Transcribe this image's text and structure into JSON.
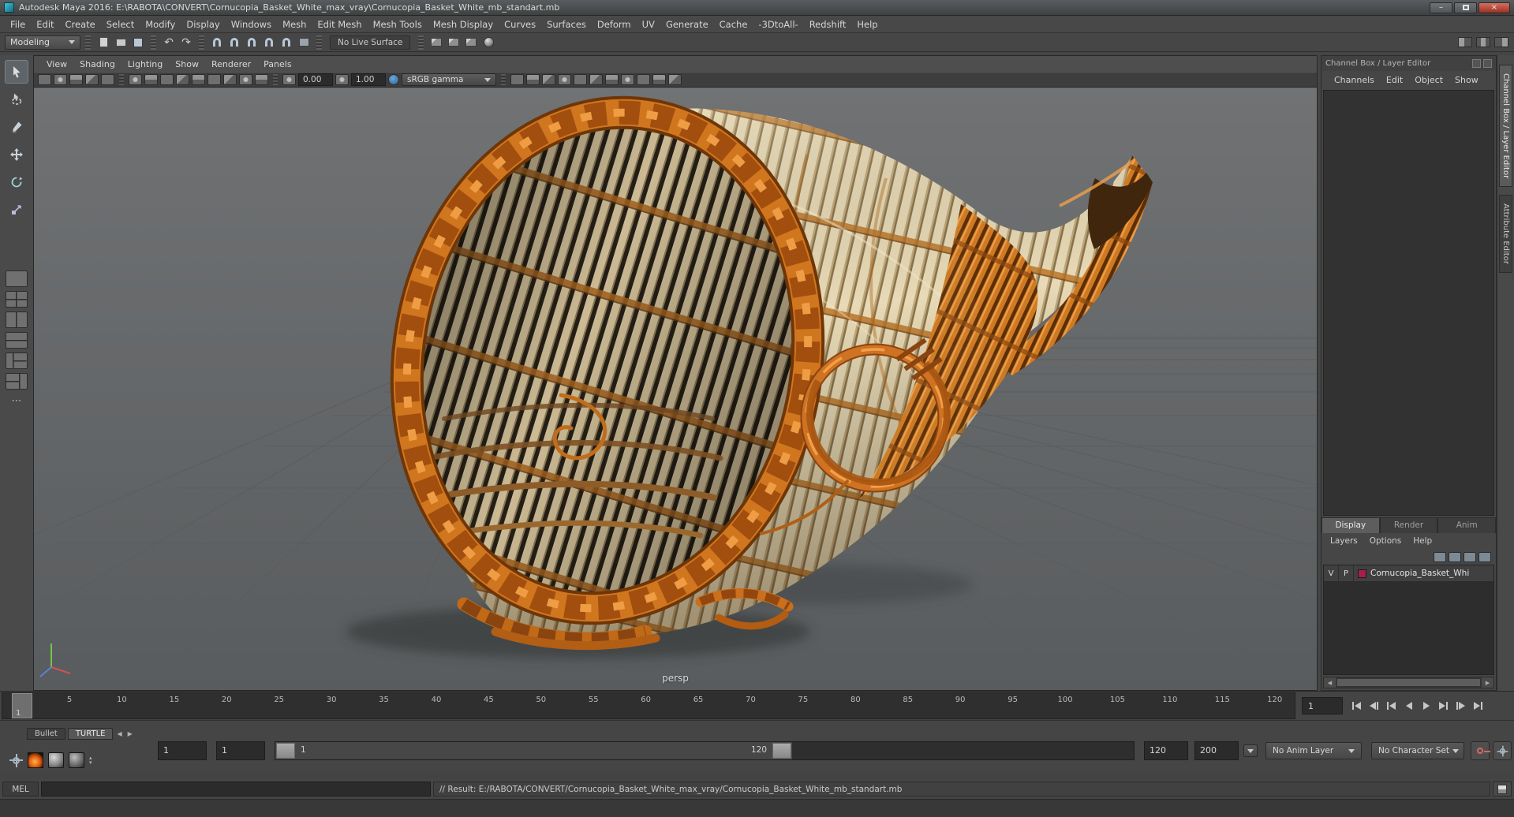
{
  "window": {
    "title": "Autodesk Maya 2016: E:\\RABOTA\\CONVERT\\Cornucopia_Basket_White_max_vray\\Cornucopia_Basket_White_mb_standart.mb"
  },
  "icons": {
    "minimize": "–",
    "close": "×",
    "undo": "↶",
    "redo": "↷",
    "more": "⋯",
    "arrow_left": "◀",
    "arrow_right": "▶",
    "spinner_up": "▴",
    "spinner_down": "▾"
  },
  "menu_bar": {
    "items": [
      "File",
      "Edit",
      "Create",
      "Select",
      "Modify",
      "Display",
      "Windows",
      "Mesh",
      "Edit Mesh",
      "Mesh Tools",
      "Mesh Display",
      "Curves",
      "Surfaces",
      "Deform",
      "UV",
      "Generate",
      "Cache",
      "-3DtoAll-",
      "Redshift",
      "Help"
    ]
  },
  "status_line": {
    "mode": "Modeling",
    "live_surface": "No Live Surface"
  },
  "viewport": {
    "menus": [
      "View",
      "Shading",
      "Lighting",
      "Show",
      "Renderer",
      "Panels"
    ],
    "exposure": "0.00",
    "gamma": "1.00",
    "color_space": "sRGB gamma",
    "camera_label": "persp"
  },
  "channel_box": {
    "header": "Channel Box / Layer Editor",
    "menus": [
      "Channels",
      "Edit",
      "Object",
      "Show"
    ]
  },
  "layer_editor": {
    "tabs": [
      "Display",
      "Render",
      "Anim"
    ],
    "menus": [
      "Layers",
      "Options",
      "Help"
    ],
    "layers": [
      {
        "visible": "V",
        "playback": "P",
        "name": "Cornucopia_Basket_Whi",
        "color": "#a61e4d"
      }
    ]
  },
  "side_tabs": [
    "Channel Box / Layer Editor",
    "Attribute Editor"
  ],
  "timeline": {
    "ticks": [
      "5",
      "10",
      "15",
      "20",
      "25",
      "30",
      "35",
      "40",
      "45",
      "50",
      "55",
      "60",
      "65",
      "70",
      "75",
      "80",
      "85",
      "90",
      "95",
      "100",
      "105",
      "110",
      "115",
      "120"
    ],
    "playhead_frame": "1",
    "current_frame": "1"
  },
  "range_slider": {
    "anim_start": "1",
    "playback_start": "1",
    "range_start_label": "1",
    "range_end_label": "120",
    "playback_end": "120",
    "anim_end": "200",
    "anim_layer": "No Anim Layer",
    "character_set": "No Character Set"
  },
  "shelf_tabs": {
    "items": [
      "Bullet",
      "TURTLE"
    ]
  },
  "command_line": {
    "label": "MEL",
    "result": "// Result: E:/RABOTA/CONVERT/Cornucopia_Basket_White_max_vray/Cornucopia_Basket_White_mb_standart.mb"
  },
  "colors": {
    "viewport_top": "#707274",
    "viewport_bottom": "#595c5e",
    "basket_orange": "#cf7a22",
    "basket_cream": "#e8dab6",
    "layer_color": "#a61e4d"
  }
}
